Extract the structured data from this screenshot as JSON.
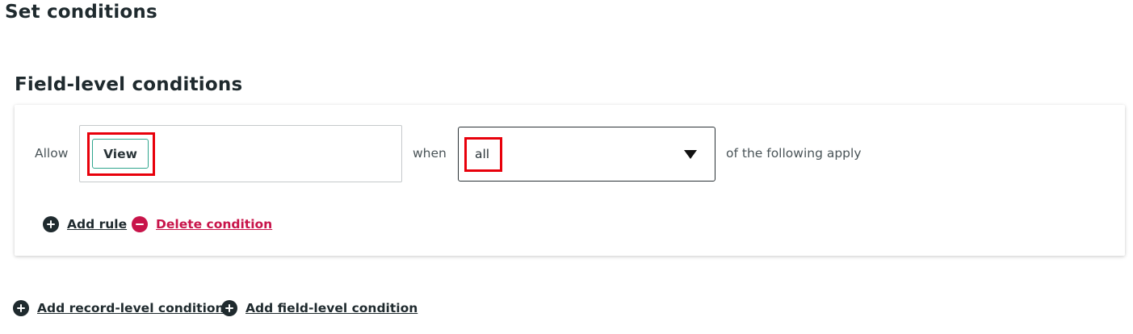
{
  "page": {
    "title": "Set conditions"
  },
  "field_level": {
    "title": "Field-level conditions",
    "allow_label": "Allow",
    "chip_label": "View",
    "when_label": "when",
    "select_value": "all",
    "following_label": "of the following apply",
    "add_rule_label": "Add rule",
    "delete_condition_label": "Delete condition"
  },
  "footer": {
    "add_record_label": "Add record-level condition",
    "add_field_label": "Add field-level condition"
  },
  "colors": {
    "text_dark": "#1f2a2e",
    "chip_border": "#2fa58d",
    "delete": "#c8144a",
    "highlight": "#e8000b"
  },
  "icons": {
    "add": "plus-circle-icon",
    "delete": "minus-circle-icon",
    "dropdown": "caret-down-icon"
  }
}
